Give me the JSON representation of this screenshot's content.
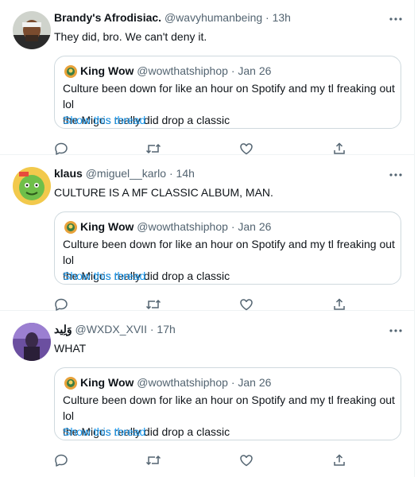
{
  "feed": {
    "tweets": [
      {
        "display_name": "Brandy's Afrodisiac.",
        "handle": "@wavyhumanbeing",
        "separator": "·",
        "time": "13h",
        "text": "They did, bro. We can't deny it.",
        "avatar_icon": "avatar-headband-photo",
        "quote": {
          "display_name": "King Wow",
          "handle": "@wowthatshiphop",
          "separator": "·",
          "time": "Jan 26",
          "line1": "Culture been down for like an hour on Spotify and my tl freaking out lol",
          "line2": "the Migos really did drop a classic",
          "show_thread": "Show this thread"
        }
      },
      {
        "display_name": "klaus",
        "handle": "@miguel__karlo",
        "separator": "·",
        "time": "14h",
        "text": "CULTURE IS A MF CLASSIC ALBUM, MAN.",
        "avatar_icon": "avatar-green-cartoon",
        "quote": {
          "display_name": "King Wow",
          "handle": "@wowthatshiphop",
          "separator": "·",
          "time": "Jan 26",
          "line1": "Culture been down for like an hour on Spotify and my tl freaking out lol",
          "line2": "the Migos really did drop a classic",
          "show_thread": "Show this thread"
        }
      },
      {
        "display_name": "وَلِيد",
        "handle": "@WXDX_XVII",
        "separator": "·",
        "time": "17h",
        "text": "WHAT",
        "avatar_icon": "avatar-purple-photo",
        "quote": {
          "display_name": "King Wow",
          "handle": "@wowthatshiphop",
          "separator": "·",
          "time": "Jan 26",
          "line1": "Culture been down for like an hour on Spotify and my tl freaking out lol",
          "line2": "the Migos really did drop a classic",
          "show_thread": "Show this thread"
        }
      }
    ]
  },
  "colors": {
    "text": "#0f1419",
    "muted": "#536471",
    "link": "#1d9bf0",
    "border": "#cfd9de",
    "divider": "#eff3f4"
  }
}
